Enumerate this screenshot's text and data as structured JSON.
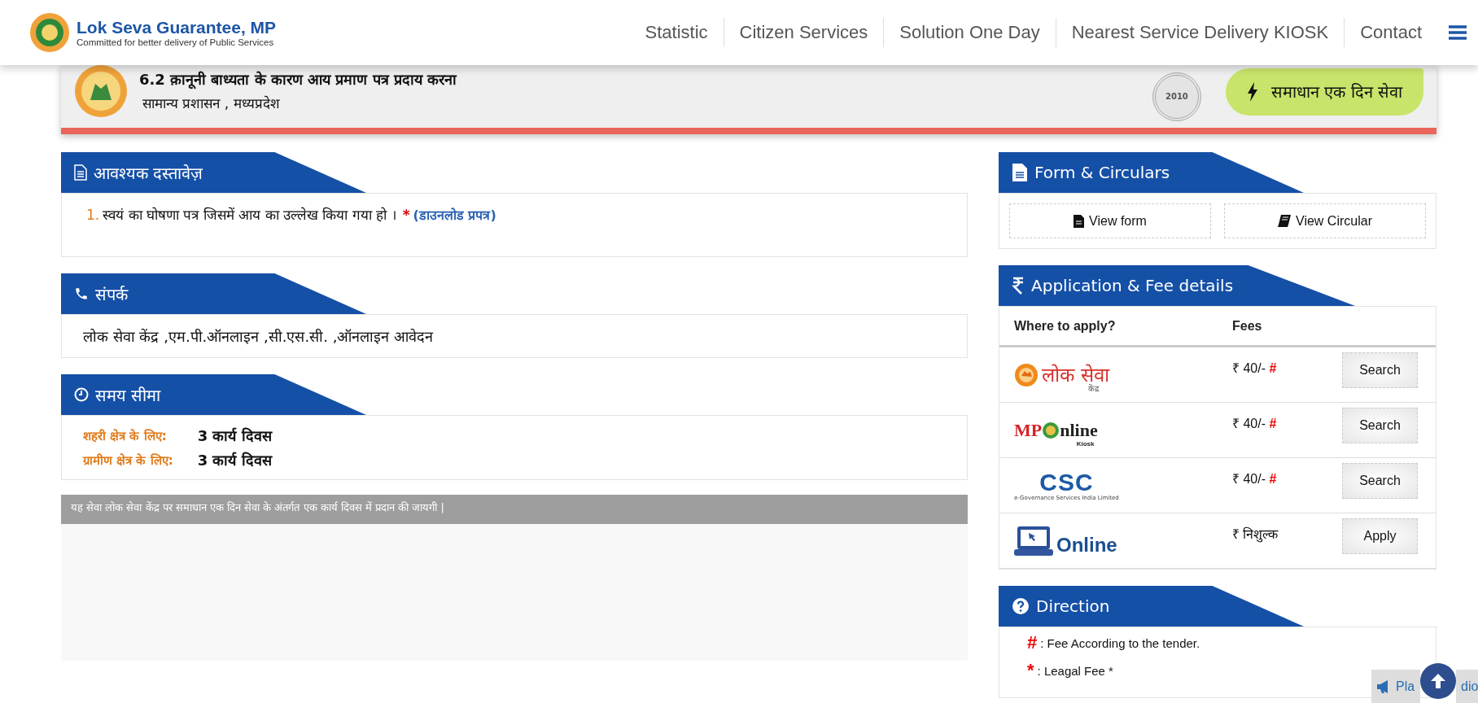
{
  "header": {
    "brand": {
      "title": "Lok Seva Guarantee, MP",
      "tagline": "Committed for better delivery of Public Services"
    },
    "nav": [
      {
        "label": "Statistic"
      },
      {
        "label": "Citizen Services"
      },
      {
        "label": "Solution One Day"
      },
      {
        "label": "Nearest Service Delivery KIOSK"
      },
      {
        "label": "Contact"
      }
    ]
  },
  "service": {
    "title": "6.2 क़ानूनी बाध्यता के कारण आय प्रमाण पत्र प्रदाय करना",
    "department": "सामान्य प्रशासन , मध्यप्रदेश",
    "seal_year": "2010",
    "badge": "समाधान एक दिन सेवा"
  },
  "documents": {
    "title": "आवश्यक दस्तावेज़",
    "items": [
      {
        "number": "1.",
        "text": "स्वयं का घोषणा पत्र जिसमें आय का उल्लेख किया गया हो ।",
        "required": "*",
        "link": "(डाउनलोड प्रपत्र)"
      }
    ]
  },
  "contact": {
    "title": "संपर्क",
    "text": "लोक सेवा केंद्र ,एम.पी.ऑनलाइन ,सी.एस.सी. ,ऑनलाइन आवेदन"
  },
  "time_limit": {
    "title": "समय सीमा",
    "rows": [
      {
        "label": "शहरी क्षेत्र के लिए:",
        "value": "3 कार्य दिवस"
      },
      {
        "label": "ग्रामीण क्षेत्र के लिए:",
        "value": "3 कार्य दिवस"
      }
    ]
  },
  "note": "यह सेवा लोक सेवा केंद्र पर समाधान एक दिन सेवा के अंतर्गत एक कार्य दिवस में प्रदान की जायगी |",
  "forms": {
    "title": "Form & Circulars",
    "buttons": [
      {
        "kind": "form",
        "label": "View form"
      },
      {
        "kind": "circular",
        "label": "View Circular"
      }
    ]
  },
  "fees": {
    "title": "Application & Fee details",
    "columns": [
      "Where to apply?",
      "Fees"
    ],
    "rows": [
      {
        "kind": "lok-seva",
        "logo": [
          "लोक सेवा",
          "केंद्र"
        ],
        "fee": "₹ 40/-",
        "mark": "#",
        "action": "Search"
      },
      {
        "kind": "mponline",
        "logo": [
          "MP",
          "nline",
          "Kiosk"
        ],
        "fee": "₹ 40/-",
        "mark": "#",
        "action": "Search"
      },
      {
        "kind": "csc",
        "logo": [
          "CSC",
          "e-Governance Services India Limited"
        ],
        "fee": "₹ 40/-",
        "mark": "#",
        "action": "Search"
      },
      {
        "kind": "online",
        "logo": [
          "Online"
        ],
        "fee": "₹ निशुल्क",
        "action": "Apply"
      }
    ]
  },
  "direction": {
    "title": "Direction",
    "notes": [
      {
        "mark": "#",
        "text": ": Fee According to the tender."
      },
      {
        "mark": "*",
        "text": ": Leagal Fee *"
      }
    ]
  },
  "radio": {
    "label_start": "Pla",
    "label_end": "dio"
  }
}
